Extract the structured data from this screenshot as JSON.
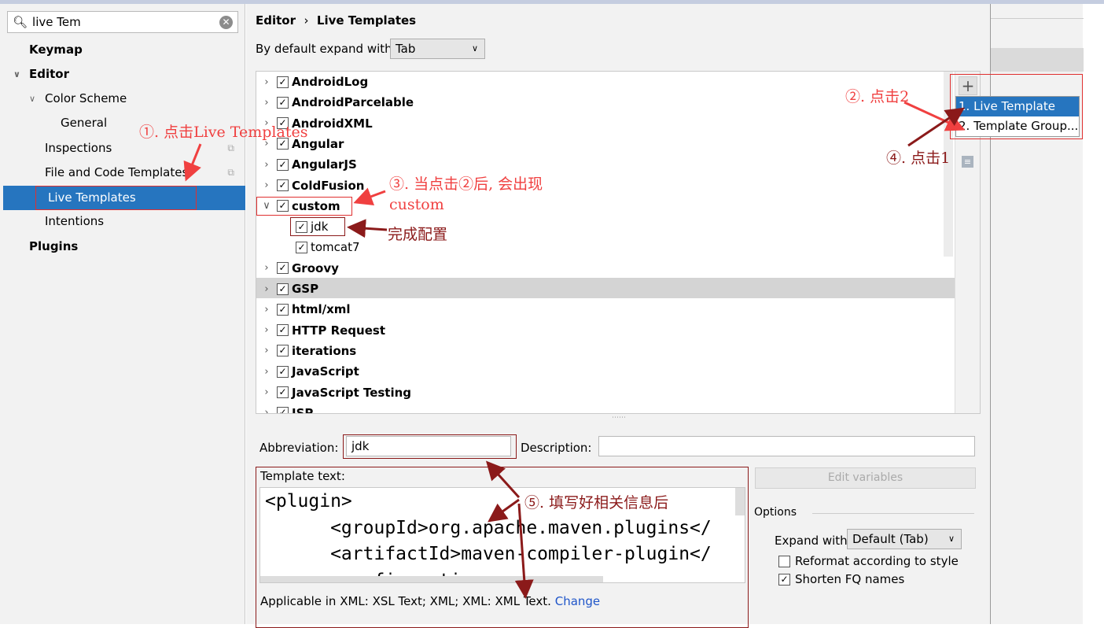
{
  "search": {
    "value": "live Tem"
  },
  "sidebar": {
    "items": [
      {
        "label": "Keymap"
      },
      {
        "label": "Editor"
      },
      {
        "label": "Color Scheme"
      },
      {
        "label": "General"
      },
      {
        "label": "Inspections"
      },
      {
        "label": "File and Code Templates"
      },
      {
        "label": "Live Templates"
      },
      {
        "label": "Intentions"
      },
      {
        "label": "Plugins"
      }
    ]
  },
  "breadcrumb": {
    "parent": "Editor",
    "sep": "›",
    "current": "Live Templates"
  },
  "expand_default": {
    "label": "By default expand with",
    "value": "Tab"
  },
  "tree": [
    {
      "label": "AndroidLog"
    },
    {
      "label": "AndroidParcelable"
    },
    {
      "label": "AndroidXML"
    },
    {
      "label": "Angular"
    },
    {
      "label": "AngularJS"
    },
    {
      "label": "ColdFusion"
    },
    {
      "label": "custom"
    },
    {
      "label": "jdk"
    },
    {
      "label": "tomcat7"
    },
    {
      "label": "Groovy"
    },
    {
      "label": "GSP"
    },
    {
      "label": "html/xml"
    },
    {
      "label": "HTTP Request"
    },
    {
      "label": "iterations"
    },
    {
      "label": "JavaScript"
    },
    {
      "label": "JavaScript Testing"
    },
    {
      "label": "JSP"
    }
  ],
  "popup": {
    "items": [
      "1. Live Template",
      "2. Template Group..."
    ]
  },
  "form": {
    "abbr_label": "Abbreviation:",
    "abbr_value": "jdk",
    "desc_label": "Description:",
    "desc_value": "",
    "template_label": "Template text:",
    "code": [
      "<plugin>",
      "      <groupId>org.apache.maven.plugins</",
      "      <artifactId>maven-compiler-plugin</",
      "      <configuration>"
    ],
    "applicable": "Applicable in XML: XSL Text; XML; XML: XML Text.",
    "change": "Change",
    "edit_vars": "Edit variables"
  },
  "options": {
    "title": "Options",
    "expand_label": "Expand with",
    "expand_value": "Default (Tab)",
    "reformat": "Reformat according to style",
    "reformat_checked": false,
    "shorten": "Shorten FQ names",
    "shorten_checked": true
  },
  "annotations": {
    "a1": "①. 点击Live Templates",
    "a2": "②. 点击2",
    "a3": "③. 当点击②后, 会出现",
    "a3b": "custom",
    "a4": "④. 点击1",
    "a5": "⑤. 填写好相关信息后",
    "a6": "完成配置"
  }
}
